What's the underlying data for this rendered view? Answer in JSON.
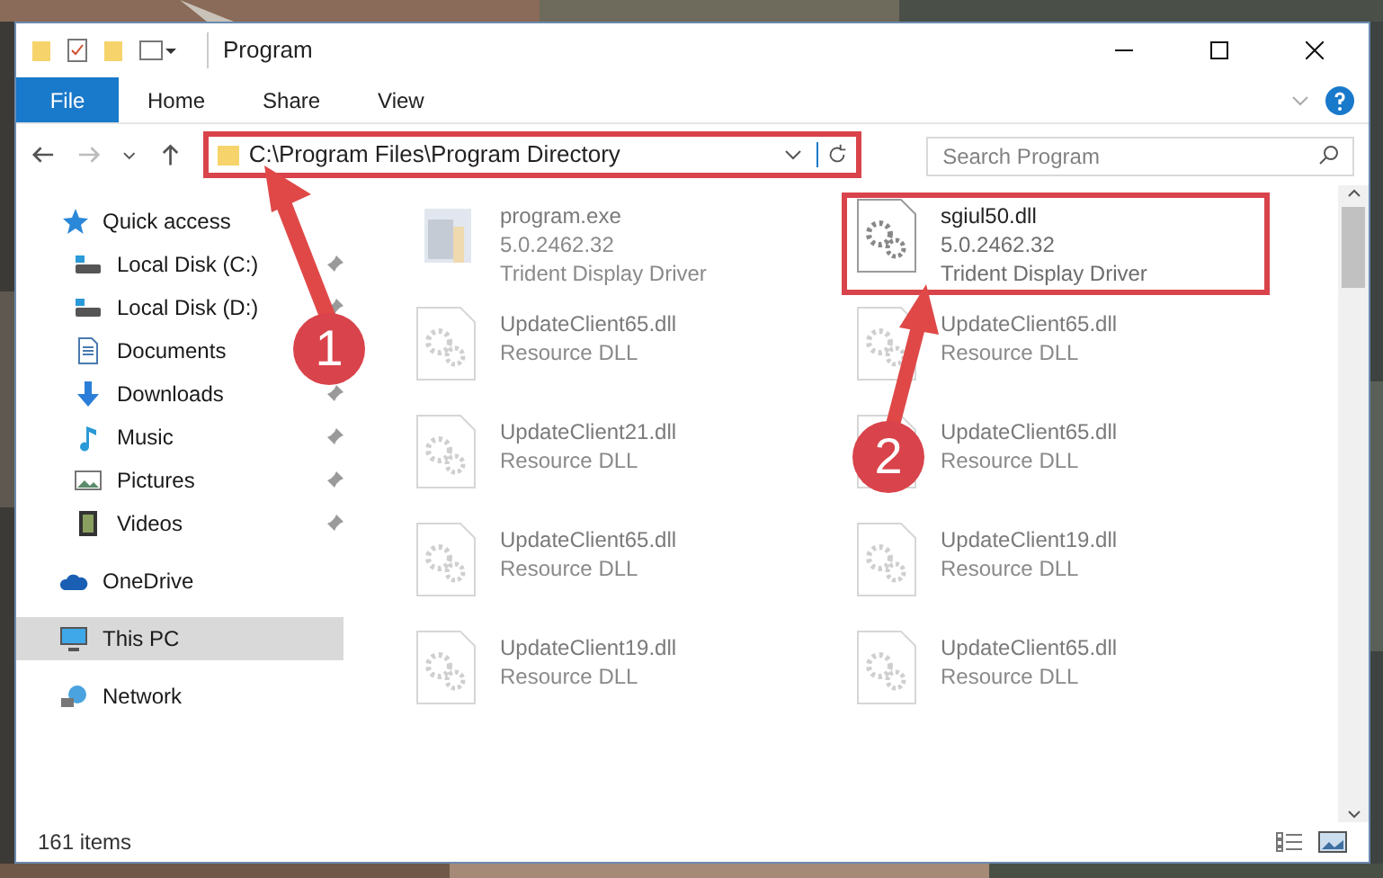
{
  "window": {
    "title": "Program"
  },
  "ribbon_tabs": [
    {
      "label": "File",
      "selected": true
    },
    {
      "label": "Home",
      "selected": false
    },
    {
      "label": "Share",
      "selected": false
    },
    {
      "label": "View",
      "selected": false
    }
  ],
  "address": {
    "path": "C:\\Program Files\\Program Directory",
    "highlighted": true
  },
  "search": {
    "placeholder": "Search Program"
  },
  "nav": [
    {
      "label": "Quick access",
      "kind": "star",
      "selected": false,
      "children": [
        {
          "label": "Local Disk (C:)",
          "kind": "disk",
          "pinned": true,
          "selected": false
        },
        {
          "label": "Local Disk (D:)",
          "kind": "disk",
          "pinned": true,
          "selected": false
        },
        {
          "label": "Documents",
          "kind": "doc",
          "pinned": false,
          "selected": false
        },
        {
          "label": "Downloads",
          "kind": "download",
          "pinned": true,
          "selected": false
        },
        {
          "label": "Music",
          "kind": "music",
          "pinned": true,
          "selected": false
        },
        {
          "label": "Pictures",
          "kind": "pictures",
          "pinned": true,
          "selected": false
        },
        {
          "label": "Videos",
          "kind": "videos",
          "pinned": true,
          "selected": false
        }
      ]
    },
    {
      "label": "OneDrive",
      "kind": "cloud",
      "selected": false
    },
    {
      "label": "This PC",
      "kind": "pc",
      "selected": true
    },
    {
      "label": "Network",
      "kind": "network",
      "selected": false
    }
  ],
  "files": [
    {
      "name": "program.exe",
      "kind": "exe",
      "lines": [
        "5.0.2462.32",
        "Trident Display Driver"
      ],
      "dimmed": true,
      "highlighted": false
    },
    {
      "name": "sgiul50.dll",
      "kind": "dll",
      "lines": [
        "5.0.2462.32",
        "Trident Display Driver"
      ],
      "dimmed": false,
      "highlighted": true
    },
    {
      "name": "UpdateClient65.dll",
      "kind": "dll",
      "lines": [
        "Resource DLL"
      ],
      "dimmed": true,
      "highlighted": false
    },
    {
      "name": "UpdateClient65.dll",
      "kind": "dll",
      "lines": [
        "Resource DLL"
      ],
      "dimmed": true,
      "highlighted": false
    },
    {
      "name": "UpdateClient21.dll",
      "kind": "dll",
      "lines": [
        "Resource DLL"
      ],
      "dimmed": true,
      "highlighted": false
    },
    {
      "name": "UpdateClient65.dll",
      "kind": "dll",
      "lines": [
        "Resource DLL"
      ],
      "dimmed": true,
      "highlighted": false
    },
    {
      "name": "UpdateClient65.dll",
      "kind": "dll",
      "lines": [
        "Resource DLL"
      ],
      "dimmed": true,
      "highlighted": false
    },
    {
      "name": "UpdateClient19.dll",
      "kind": "dll",
      "lines": [
        "Resource DLL"
      ],
      "dimmed": true,
      "highlighted": false
    },
    {
      "name": "UpdateClient19.dll",
      "kind": "dll",
      "lines": [
        "Resource DLL"
      ],
      "dimmed": true,
      "highlighted": false
    },
    {
      "name": "UpdateClient65.dll",
      "kind": "dll",
      "lines": [
        "Resource DLL"
      ],
      "dimmed": true,
      "highlighted": false
    }
  ],
  "status_bar": {
    "count": "161 items"
  },
  "callouts": [
    {
      "label": "1"
    },
    {
      "label": "2"
    }
  ]
}
